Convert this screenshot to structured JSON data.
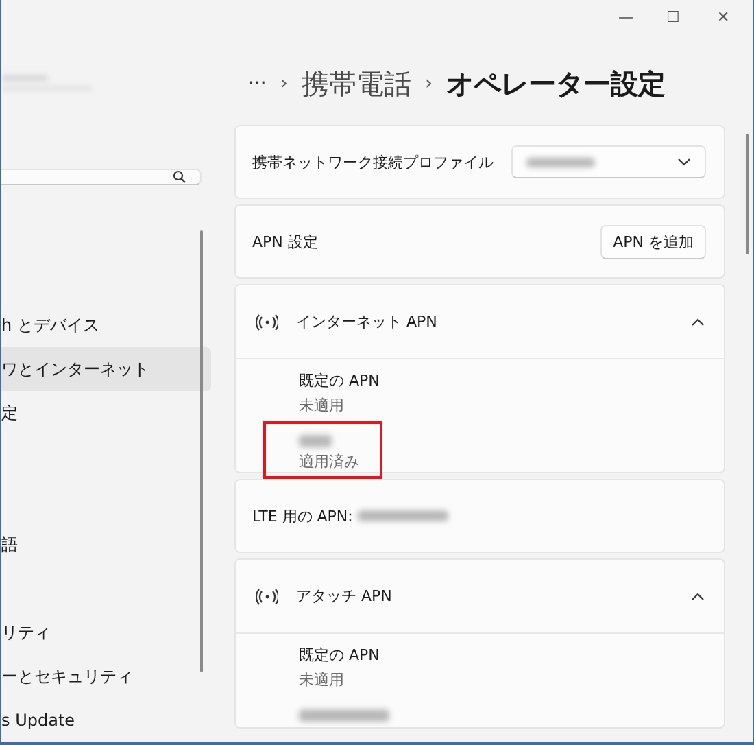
{
  "window": {
    "controls": [
      "—",
      "☐",
      "✕"
    ]
  },
  "sidebar": {
    "items": [
      {
        "kind": "item",
        "label": "h とデバイス",
        "selected": false
      },
      {
        "kind": "item",
        "label": "ワとインターネット",
        "selected": true
      },
      {
        "kind": "item",
        "label": "定",
        "selected": false
      },
      {
        "kind": "spacer"
      },
      {
        "kind": "spacer"
      },
      {
        "kind": "item",
        "label": "語",
        "selected": false
      },
      {
        "kind": "spacer"
      },
      {
        "kind": "item",
        "label": "リティ",
        "selected": false
      },
      {
        "kind": "item",
        "label": "ーとセキュリティ",
        "selected": false
      },
      {
        "kind": "item",
        "label": "s Update",
        "selected": false
      }
    ]
  },
  "breadcrumb": {
    "more": "···",
    "separator": "›",
    "parent": "携帯電話",
    "current": "オペレーター設定"
  },
  "profile_row": {
    "label": "携帯ネットワーク接続プロファイル"
  },
  "apn_row": {
    "label": "APN 設定",
    "button": "APN を追加"
  },
  "sections": [
    {
      "kind": "expander",
      "title": "インターネット APN",
      "expanded": true,
      "entries": [
        {
          "name": "既定の APN",
          "status": "未適用",
          "highlighted": false
        },
        {
          "status": "適用済み",
          "highlighted": true
        }
      ]
    },
    {
      "kind": "info",
      "label": "LTE 用の APN:"
    },
    {
      "kind": "expander",
      "title": "アタッチ APN",
      "expanded": true,
      "entries": [
        {
          "name": "既定の APN",
          "status": "未適用",
          "highlighted": false
        },
        {
          "highlighted": false
        }
      ]
    }
  ]
}
